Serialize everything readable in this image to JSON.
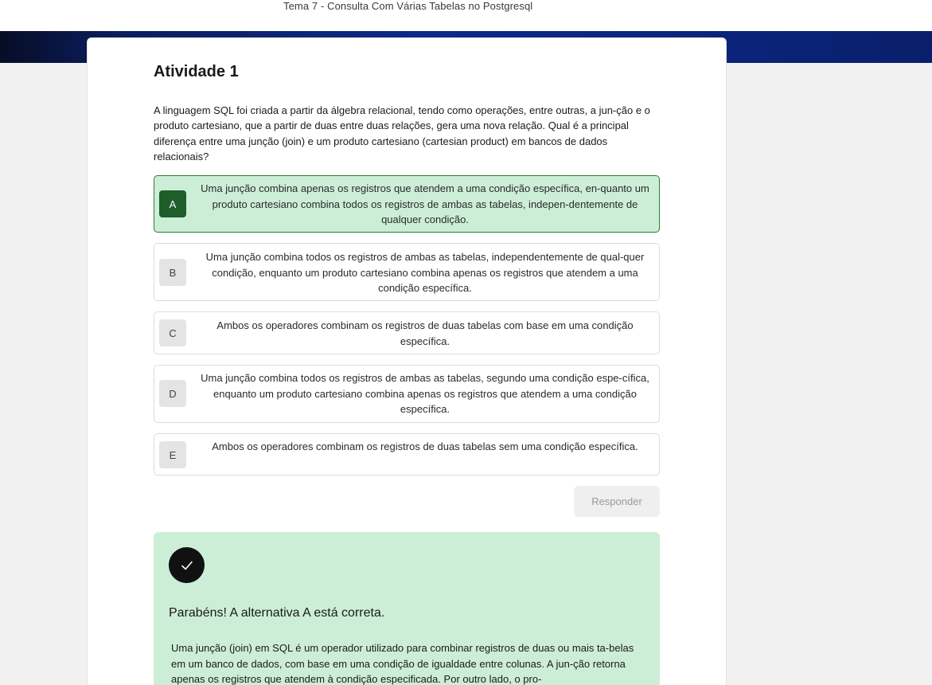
{
  "header": {
    "topic": "Tema 7 - Consulta Com Várias Tabelas no Postgresql"
  },
  "activity": {
    "title": "Atividade 1",
    "question": "A linguagem SQL foi criada a partir da álgebra relacional, tendo como operações, entre outras, a jun-ção e o produto cartesiano, que a partir de duas entre duas relações, gera uma nova relação. Qual é a principal diferença entre uma junção (join) e um produto cartesiano (cartesian product) em bancos de dados relacionais?"
  },
  "options": [
    {
      "letter": "A",
      "text": "Uma junção combina apenas os registros que atendem a uma condição específica, en-quanto um produto cartesiano combina todos os registros de ambas as tabelas, indepen-dentemente de qualquer condição.",
      "selected": true
    },
    {
      "letter": "B",
      "text": "Uma junção combina todos os registros de ambas as tabelas, independentemente de qual-quer condição, enquanto um produto cartesiano combina apenas os registros que atendem a uma condição específica.",
      "selected": false
    },
    {
      "letter": "C",
      "text": "Ambos os operadores combinam os registros de duas tabelas com base em uma condição específica.",
      "selected": false
    },
    {
      "letter": "D",
      "text": "Uma junção combina todos os registros de ambas as tabelas, segundo uma condição espe-cífica, enquanto um produto cartesiano combina apenas os registros que atendem a uma condição específica.",
      "selected": false
    },
    {
      "letter": "E",
      "text": "Ambos os operadores combinam os registros de duas tabelas sem uma condição específica.",
      "selected": false
    }
  ],
  "actions": {
    "respond_label": "Responder"
  },
  "feedback": {
    "icon": "check-icon",
    "title": "Parabéns! A alternativa A está correta.",
    "text": "Uma junção (join) em SQL é um operador utilizado para combinar registros de duas ou mais ta-belas em um banco de dados, com base em uma condição de igualdade entre colunas. A jun-ção retorna apenas os registros que atendem à condição especificada. Por outro lado, o pro-"
  },
  "colors": {
    "selected_bg": "#cdeed6",
    "selected_letter_bg": "#1d5e2b",
    "header_band": "#0d2a8a"
  }
}
